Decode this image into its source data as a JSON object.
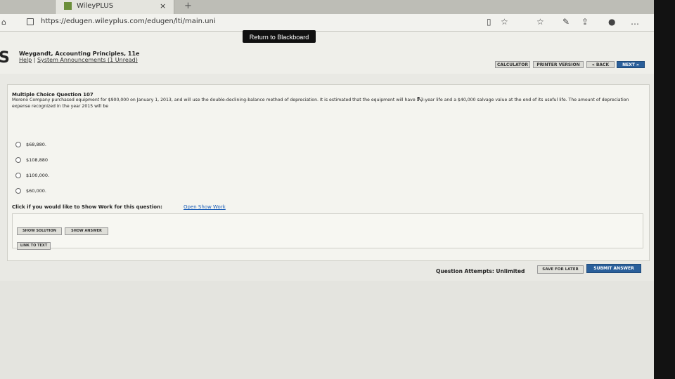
{
  "browser": {
    "tab_title": "WileyPLUS",
    "tab_close": "×",
    "new_tab": "+",
    "url": "https://edugen.wileyplus.com/edugen/lti/main.uni",
    "icons": [
      "home-icon",
      "lock-icon",
      "reading-view-icon",
      "favorite-star-icon",
      "favorites-icon",
      "notes-icon",
      "share-icon",
      "profile-icon",
      "more-icon"
    ]
  },
  "header": {
    "return_button": "Return to Blackboard",
    "brand": "S",
    "course": "Weygandt, Accounting Principles, 11e",
    "help": "Help",
    "separator": "|",
    "announcements": "System Announcements (1 Unread)"
  },
  "toolbar": {
    "calculator": "CALCULATOR",
    "printer": "PRINTER VERSION",
    "back": "« BACK",
    "next": "NEXT »"
  },
  "question": {
    "title": "Multiple Choice Question 107",
    "text": "Moreno Company purchased equipment for $900,000 on January 1, 2013, and will use the double-declining-balance method of depreciation. It is estimated that the equipment will have a 3-year life and a $40,000 salvage value at the end of its useful life. The amount of depreciation expense recognized in the year 2015 will be",
    "options": [
      "$68,880.",
      "$108,880",
      "$100,000.",
      "$60,000."
    ],
    "show_work_prompt": "Click if you would like to Show Work for this question:",
    "show_work_link": "Open Show Work",
    "show_solution": "SHOW SOLUTION",
    "show_answer": "SHOW ANSWER",
    "link_to_text": "LINK TO TEXT"
  },
  "footer": {
    "attempts": "Question Attempts: Unlimited",
    "save_later": "SAVE FOR LATER",
    "submit": "SUBMIT ANSWER"
  }
}
